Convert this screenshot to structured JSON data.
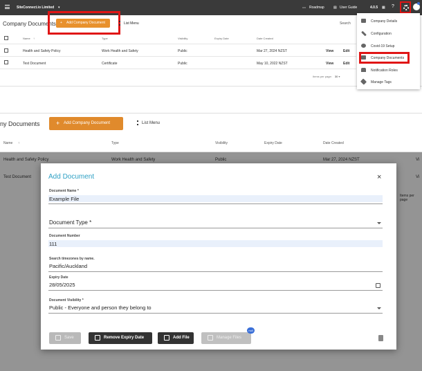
{
  "top": {
    "org_name": "SiteConnect.io Limited",
    "roadmap": "Roadmap",
    "user_guide": "User Guide",
    "version": "4.0.5",
    "page_title": "Company Documents",
    "add_button": "Add Company Document",
    "list_menu": "List Menu",
    "search_placeholder": "Search",
    "columns": [
      "Name",
      "Type",
      "Visibility",
      "Expiry Date",
      "Date Created"
    ],
    "rows": [
      {
        "name": "Health and Safety Policy",
        "type": "Work Health and Safety",
        "visibility": "Public",
        "date_created": "Mar 27, 2024 NZST",
        "view": "View",
        "edit": "Edit"
      },
      {
        "name": "Test Document",
        "type": "Certificate",
        "visibility": "Public",
        "date_created": "May 10, 2022 NZST",
        "view": "View",
        "edit": "Edit"
      }
    ],
    "items_per_page_label": "Items per page:",
    "items_per_page": "30",
    "settings_menu": [
      {
        "label": "Company Details",
        "icon": "building-icon"
      },
      {
        "label": "Configuration",
        "icon": "wrench-icon"
      },
      {
        "label": "Covid-19 Setup",
        "icon": "virus-icon"
      },
      {
        "label": "Company Documents",
        "icon": "folder-icon"
      },
      {
        "label": "Notification Roles",
        "icon": "bell-icon"
      },
      {
        "label": "Manage Tags",
        "icon": "tag-icon"
      }
    ],
    "accent_color": "#e8912d",
    "highlight_color": "#e01515"
  },
  "bottom": {
    "page_title": "ny Documents",
    "add_button": "Add Company Document",
    "list_menu": "List Menu",
    "columns": [
      "Name",
      "Type",
      "Visibility",
      "Expiry Date",
      "Date Created"
    ],
    "rows": [
      {
        "name": "Health and Safety Policy",
        "type": "Work Health and Safety",
        "visibility": "Public",
        "date_created": "Mar 27, 2024 NZST",
        "view": "Vi"
      },
      {
        "name": "Test Document",
        "view": "Vi"
      }
    ],
    "items_per_page_partial": "Items per page"
  },
  "dialog": {
    "title": "Add Document",
    "close": "×",
    "doc_name_label": "Document Name *",
    "doc_name_value": "Example File",
    "doc_type_label": "Document Type *",
    "doc_number_label": "Document Number",
    "doc_number_value": "111",
    "timezone_label": "Search timezones by name.",
    "timezone_value": "Pacific/Auckland",
    "expiry_label": "Expiry Date",
    "expiry_value": "28/05/2025",
    "visibility_label": "Document Visibility *",
    "visibility_value": "Public - Everyone and person they belong to",
    "buttons": {
      "save": "Save",
      "remove_expiry": "Remove Expiry Date",
      "add_file": "Add File",
      "manage_files": "Manage Files",
      "badge": "null"
    },
    "title_color": "#2ea0c4"
  }
}
